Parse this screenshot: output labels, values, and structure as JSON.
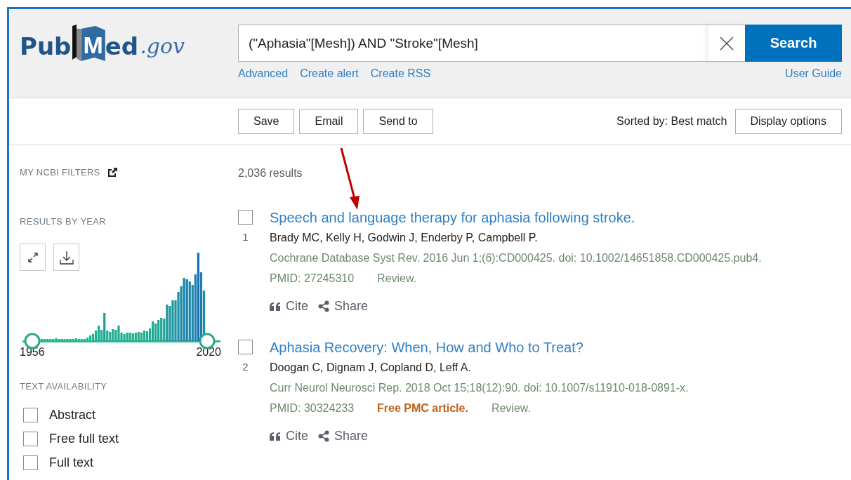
{
  "logo": {
    "pub": "Pub",
    "med": "Med",
    "gov": ".gov"
  },
  "search": {
    "value": "(\"Aphasia\"[Mesh]) AND \"Stroke\"[Mesh]",
    "button": "Search"
  },
  "search_links": [
    "Advanced",
    "Create alert",
    "Create RSS"
  ],
  "user_guide": "User Guide",
  "toolbar": {
    "buttons": [
      "Save",
      "Email",
      "Send to"
    ],
    "sort_label": "Sorted by: Best match",
    "display_options": "Display options"
  },
  "sidebar": {
    "my_ncbi_filters": "MY NCBI FILTERS",
    "results_by_year": {
      "title": "RESULTS BY YEAR",
      "start_year": "1956",
      "end_year": "2020"
    },
    "text_availability": {
      "title": "TEXT AVAILABILITY",
      "options": [
        {
          "label": "Abstract",
          "checked": false
        },
        {
          "label": "Free full text",
          "checked": false
        },
        {
          "label": "Full text",
          "checked": false
        }
      ]
    }
  },
  "results_count": "2,036 results",
  "results": [
    {
      "number": "1",
      "checked": false,
      "title": "Speech and language therapy for aphasia following stroke.",
      "authors": "Brady MC, Kelly H, Godwin J, Enderby P, Campbell P.",
      "citation": "Cochrane Database Syst Rev. 2016 Jun 1;(6):CD000425. doi: 10.1002/14651858.CD000425.pub4.",
      "pmid": "PMID: 27245310",
      "type": "Review.",
      "actions": [
        {
          "kind": "cite",
          "label": "Cite"
        },
        {
          "kind": "share",
          "label": "Share"
        }
      ]
    },
    {
      "number": "2",
      "checked": false,
      "title": "Aphasia Recovery: When, How and Who to Treat?",
      "authors": "Doogan C, Dignam J, Copland D, Leff A.",
      "citation": "Curr Neurol Neurosci Rep. 2018 Oct 15;18(12):90. doi: 10.1007/s11910-018-0891-x.",
      "pmid": "PMID: 30324233",
      "badge": "Free PMC article.",
      "type": "Review.",
      "actions": [
        {
          "kind": "cite",
          "label": "Cite"
        },
        {
          "kind": "share",
          "label": "Share"
        }
      ]
    }
  ],
  "annotation": {
    "kind": "arrow"
  }
}
